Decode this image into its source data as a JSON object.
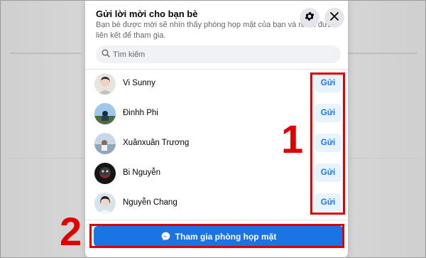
{
  "dialog": {
    "title": "Gửi lời mời cho bạn bè",
    "subtitle": "Bạn bè được mời sẽ nhìn thấy phòng họp mặt của bạn và nhấn đươ liên kết để tham gia.",
    "search": {
      "placeholder": "Tìm kiếm",
      "value": ""
    },
    "friends": [
      {
        "name": "Vi Sunny",
        "send_label": "Gửi"
      },
      {
        "name": "Đinhh Phi",
        "send_label": "Gửi"
      },
      {
        "name": "Xuânxuân Trương",
        "send_label": "Gửi"
      },
      {
        "name": "Bi Nguyễn",
        "send_label": "Gửi"
      },
      {
        "name": "Nguyễn Chang",
        "send_label": "Gửi"
      }
    ],
    "join_button_label": "Tham gia phòng họp mặt"
  },
  "annotations": {
    "marker_1": "1",
    "marker_2": "2"
  },
  "colors": {
    "accent": "#1b74e4",
    "send_button_bg": "#e7f3ff",
    "send_button_text": "#1877f2",
    "highlight": "#e00000"
  },
  "icons": [
    "gear-icon",
    "close-icon",
    "search-icon",
    "messenger-icon"
  ]
}
